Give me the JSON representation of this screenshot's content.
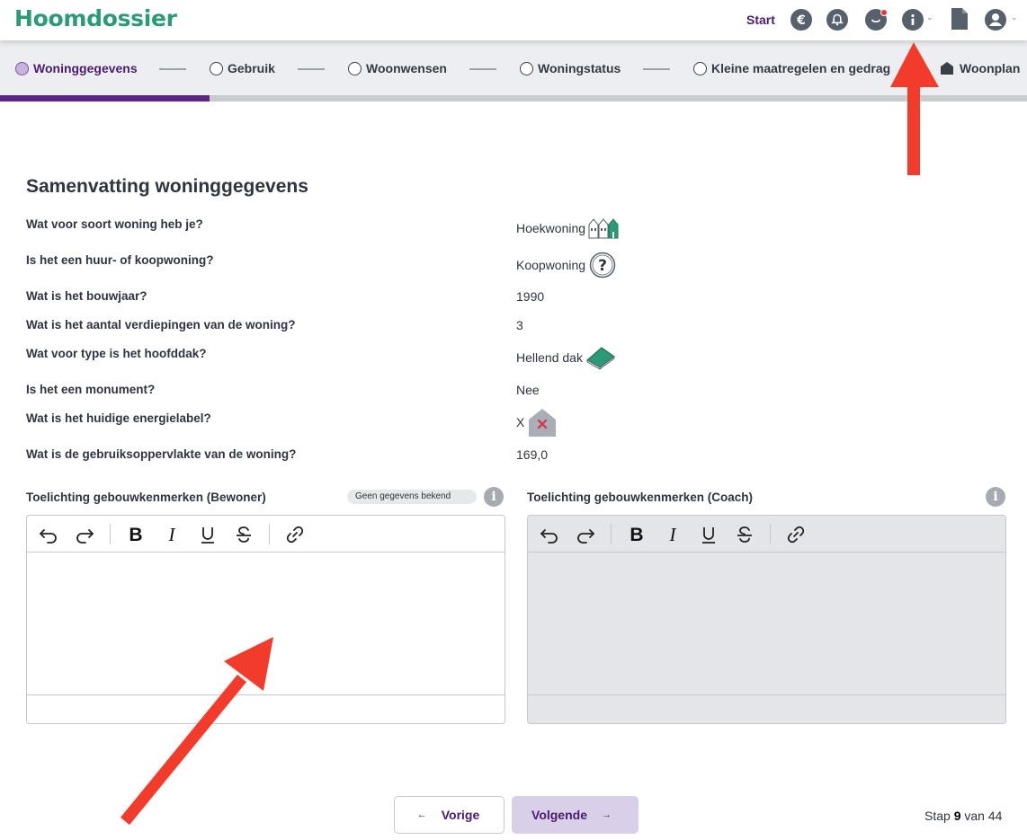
{
  "header": {
    "logo": "Hoomdossier",
    "start_label": "Start",
    "icons": [
      "euro-icon",
      "bell-icon",
      "chat-icon",
      "info-icon",
      "document-icon",
      "user-icon"
    ]
  },
  "steps": {
    "items": [
      {
        "label": "Woninggegevens",
        "active": true
      },
      {
        "label": "Gebruik",
        "active": false
      },
      {
        "label": "Woonwensen",
        "active": false
      },
      {
        "label": "Woningstatus",
        "active": false
      },
      {
        "label": "Kleine maatregelen en gedrag",
        "active": false
      },
      {
        "label": "Woonplan",
        "active": false
      }
    ],
    "progress": 0.204
  },
  "summary": {
    "title": "Samenvatting woninggegevens",
    "rows": [
      {
        "question": "Wat voor soort woning heb je?",
        "answer": "Hoekwoning"
      },
      {
        "question": "Is het een huur- of koopwoning?",
        "answer": "Koopwoning"
      },
      {
        "question": "Wat is het bouwjaar?",
        "answer": "1990"
      },
      {
        "question": "Wat is het aantal verdiepingen van de woning?",
        "answer": "3"
      },
      {
        "question": "Wat voor type is het hoofddak?",
        "answer": "Hellend dak"
      },
      {
        "question": "Is het een monument?",
        "answer": "Nee"
      },
      {
        "question": "Wat is het huidige energielabel?",
        "answer": "X"
      },
      {
        "question": "Wat is de gebruiksoppervlakte van de woning?",
        "answer": "169,0"
      }
    ]
  },
  "editors": {
    "resident": {
      "label": "Toelichting gebouwkenmerken (Bewoner)",
      "badge": "Geen gegevens bekend"
    },
    "coach": {
      "label": "Toelichting gebouwkenmerken (Coach)"
    }
  },
  "footer": {
    "prev_label": "Vorige",
    "next_label": "Volgende",
    "step_prefix": "Stap",
    "step_current": "9",
    "step_middle": "van",
    "step_total": "44"
  },
  "colors": {
    "brand_green": "#2a9a77",
    "brand_purple": "#4a1b6f",
    "progress": "#5b2783",
    "annotation_arrow": "#f23b2a"
  }
}
